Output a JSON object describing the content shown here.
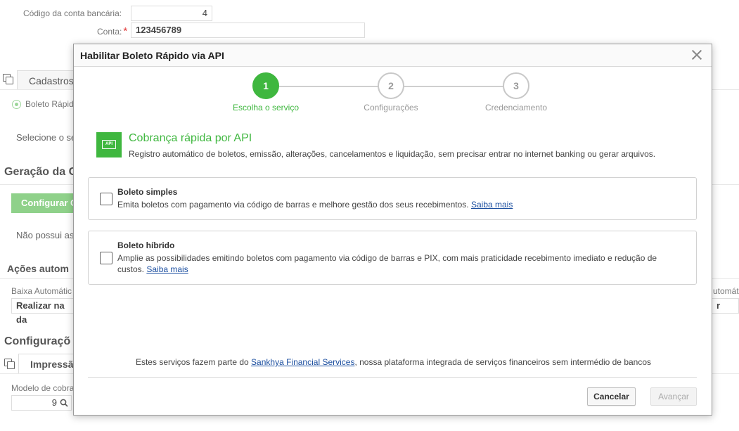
{
  "background": {
    "bank_code_label": "Código da conta bancária:",
    "bank_code_value": "4",
    "account_label": "Conta:",
    "required_mark": "*",
    "account_value": "123456789",
    "tab_cadastros": "Cadastros",
    "radio_label": "Boleto Rápid",
    "select_text": "Selecione o se",
    "section_geracao": "Geração da C",
    "configure_button": "Configurar C",
    "nao_possui": "Não possui as",
    "section_acoes": "Ações autom",
    "baixa_label": "Baixa Automátic",
    "baixa_value": "Realizar na da",
    "right_label": "utomátic",
    "right_value": "r",
    "section_configuracoes": "Configuraçõ",
    "tab_impressao": "Impressã",
    "modelo_label": "Modelo de cobra",
    "modelo_value": "9"
  },
  "dialog": {
    "title": "Habilitar Boleto Rápido via API",
    "steps": [
      {
        "number": "1",
        "label": "Escolha o serviço",
        "active": true
      },
      {
        "number": "2",
        "label": "Configurações",
        "active": false
      },
      {
        "number": "3",
        "label": "Credenciamento",
        "active": false
      }
    ],
    "service": {
      "icon_text": "API",
      "title": "Cobrança rápida por API",
      "description": "Registro automático de boletos, emissão, alterações, cancelamentos e liquidação, sem precisar entrar no internet banking ou gerar arquivos."
    },
    "options": [
      {
        "title": "Boleto simples",
        "description": "Emita boletos com pagamento via código de barras e melhore gestão dos seus recebimentos.",
        "link": "Saiba mais",
        "checked": false
      },
      {
        "title": "Boleto híbrido",
        "description": "Amplie as possibilidades emitindo boletos com pagamento via código de barras e PIX, com mais praticidade recebimento imediato e redução de custos.",
        "link": "Saiba mais",
        "checked": false
      }
    ],
    "footer": {
      "before_link": "Estes serviços fazem parte do",
      "link": "Sankhya Financial Services",
      "after_link": ", nossa plataforma integrada de serviços financeiros sem intermédio de bancos"
    },
    "buttons": {
      "cancel": "Cancelar",
      "next": "Avançar"
    },
    "colors": {
      "accent": "#3fb73f",
      "link": "#1c4fa0"
    }
  }
}
